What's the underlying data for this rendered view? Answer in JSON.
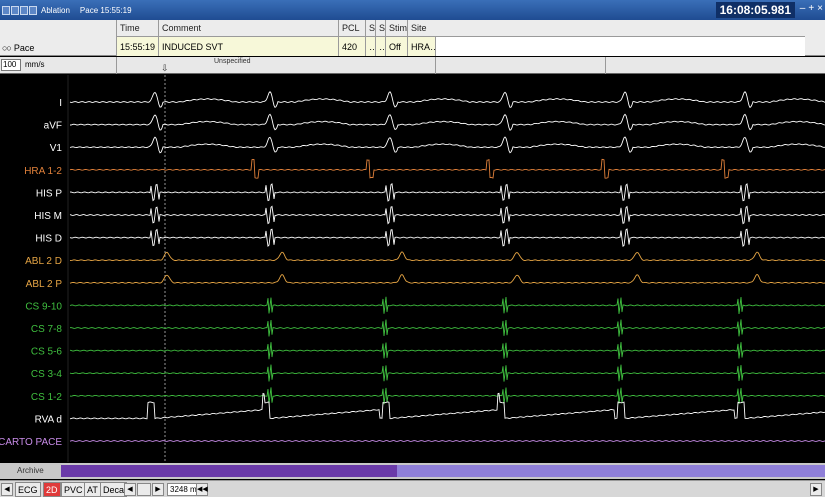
{
  "titlebar": {
    "app_title": "Ablation",
    "subtitle": "Pace  15:55:19",
    "clock": "16:08:05.981",
    "ctrl_min": "–",
    "ctrl_max": "+",
    "ctrl_close": "×"
  },
  "header": {
    "pace_label": "Pace",
    "pace_icon": "double-circle-icon",
    "columns": [
      {
        "key": "time",
        "header": "Time",
        "value": "15:55:19"
      },
      {
        "key": "comment",
        "header": "Comment",
        "value": "INDUCED SVT"
      },
      {
        "key": "pcl",
        "header": "PCL",
        "value": "420"
      },
      {
        "key": "s1",
        "header": "S",
        "value": "…"
      },
      {
        "key": "s2",
        "header": "S",
        "value": "…"
      },
      {
        "key": "stim",
        "header": "Stim",
        "value": "Off"
      },
      {
        "key": "site",
        "header": "Site",
        "value": "HRA…"
      }
    ]
  },
  "speed": {
    "value": "100",
    "unit": "mm/s",
    "marker": "Unspecified"
  },
  "channels": [
    {
      "label": "I",
      "color": "#ffffff",
      "type": "ecg"
    },
    {
      "label": "aVF",
      "color": "#ffffff",
      "type": "ecg"
    },
    {
      "label": "V1",
      "color": "#ffffff",
      "type": "ecg"
    },
    {
      "label": "HRA 1-2",
      "color": "#e0803a",
      "type": "hra"
    },
    {
      "label": "HIS P",
      "color": "#ffffff",
      "type": "his"
    },
    {
      "label": "HIS M",
      "color": "#ffffff",
      "type": "his"
    },
    {
      "label": "HIS D",
      "color": "#ffffff",
      "type": "his"
    },
    {
      "label": "ABL 2 D",
      "color": "#e6a544",
      "type": "abl"
    },
    {
      "label": "ABL 2 P",
      "color": "#e6a544",
      "type": "abl"
    },
    {
      "label": "CS 9-10",
      "color": "#3fbf3f",
      "type": "cs"
    },
    {
      "label": "CS 7-8",
      "color": "#3fbf3f",
      "type": "cs"
    },
    {
      "label": "CS 5-6",
      "color": "#3fbf3f",
      "type": "cs"
    },
    {
      "label": "CS 3-4",
      "color": "#3fbf3f",
      "type": "cs"
    },
    {
      "label": "CS 1-2",
      "color": "#3fbf3f",
      "type": "cs"
    },
    {
      "label": "RVA d",
      "color": "#ffffff",
      "type": "rva"
    },
    {
      "label": "CARTO PACE",
      "color": "#c88ce8",
      "type": "flat"
    }
  ],
  "bottom": {
    "archive_label": "Archive",
    "tabs": [
      "ECG",
      "2D",
      "PVC",
      "AT",
      "Deca"
    ],
    "active_tab": "2D",
    "time_field": "3248 ms"
  }
}
